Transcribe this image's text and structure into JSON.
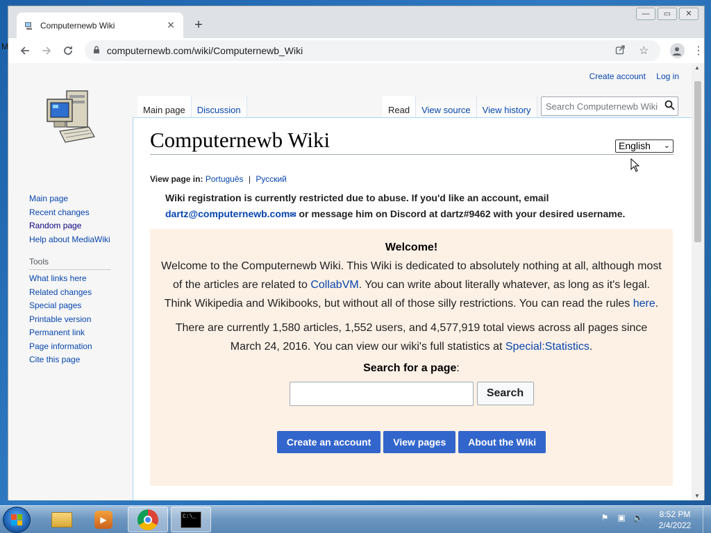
{
  "desktop": {
    "edge_text": "M"
  },
  "browser": {
    "tab_title": "Computernewb Wiki",
    "tab_close": "✕",
    "new_tab": "+",
    "url": "computernewb.com/wiki/Computernewb_Wiki",
    "window_controls": {
      "minimize": "—",
      "maximize": "▭",
      "close": "✕"
    }
  },
  "page": {
    "personal": {
      "create_account": "Create account",
      "log_in": "Log in"
    },
    "tabs_left": [
      "Main page",
      "Discussion"
    ],
    "tabs_right": [
      "Read",
      "View source",
      "View history"
    ],
    "search_placeholder": "Search Computernewb Wiki",
    "sidebar": {
      "nav": [
        "Main page",
        "Recent changes",
        "Random page",
        "Help about MediaWiki"
      ],
      "tools_heading": "Tools",
      "tools": [
        "What links here",
        "Related changes",
        "Special pages",
        "Printable version",
        "Permanent link",
        "Page information",
        "Cite this page"
      ]
    },
    "heading": "Computernewb Wiki",
    "language_select": "English",
    "view_in": {
      "label": "View page in:",
      "lang1": "Português",
      "separator": "|",
      "lang2": "Русский"
    },
    "notice": {
      "line1": "Wiki registration is currently restricted due to abuse. If you'd like an account, email",
      "email": "dartz@computernewb.com",
      "line2": " or message him on Discord at dartz#9462 with your desired username."
    },
    "welcome": {
      "title": "Welcome!",
      "p1_a": "Welcome to the Computernewb Wiki. This Wiki is dedicated to absolutely nothing at all, although most of the articles are related to ",
      "p1_link": "CollabVM",
      "p1_b": ". You can write about literally whatever, as long as it's legal. Think Wikipedia and Wikibooks, but without all of those silly restrictions. You can read the rules ",
      "p1_link2": "here",
      "p1_c": ".",
      "p2_a": "There are currently 1,580 articles, 1,552 users, and 4,577,919 total views across all pages since March 24, 2016. You can view our wiki's full statistics at ",
      "p2_link": "Special:Statistics",
      "p2_b": ".",
      "search_label": "Search for a page",
      "search_colon": ":",
      "search_button": "Search",
      "buttons": [
        "Create an account",
        "View pages",
        "About the Wiki"
      ]
    }
  },
  "taskbar": {
    "time": "8:52 PM",
    "date": "2/4/2022"
  }
}
